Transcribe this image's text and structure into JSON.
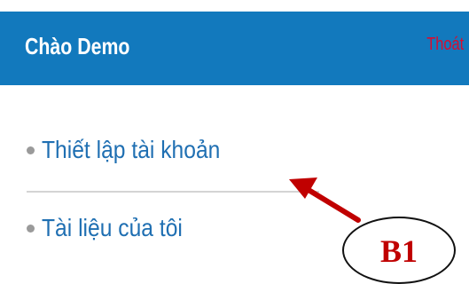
{
  "header": {
    "title": "Chào Demo",
    "logout_label": "Thoát"
  },
  "menu": {
    "items": [
      {
        "label": "Thiết lập tài khoản"
      },
      {
        "label": "Tài liệu của tôi"
      }
    ]
  },
  "annotation": {
    "badge_label": "B1"
  },
  "colors": {
    "header_bg": "#1279bd",
    "logout_text": "#d80c2f",
    "link_text": "#1f6fb2",
    "annotation_red": "#c00000"
  }
}
